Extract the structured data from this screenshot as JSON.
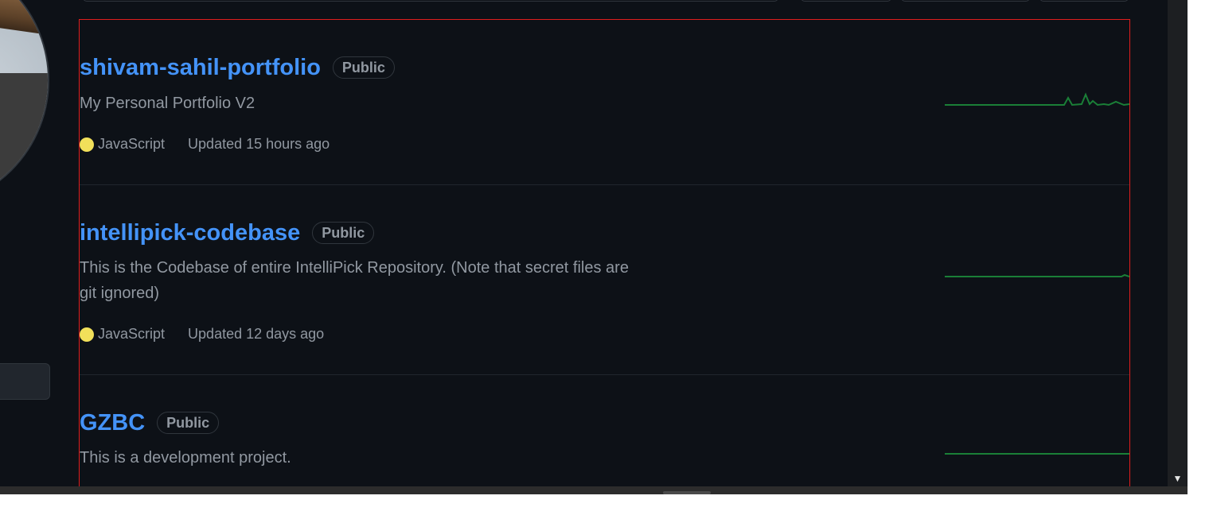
{
  "colors": {
    "background": "#0d1117",
    "link": "#4493f8",
    "muted_text": "#9198a1",
    "javascript": "#f1e05a",
    "sparkline": "#1a7f37",
    "highlight_outline": "#e01d1d"
  },
  "repositories": [
    {
      "name": "shivam-sahil-portfolio",
      "visibility": "Public",
      "description": "My Personal Portfolio V2",
      "language": "JavaScript",
      "updated": "Updated 15 hours ago"
    },
    {
      "name": "intellipick-codebase",
      "visibility": "Public",
      "description": "This is the Codebase of entire IntelliPick Repository. (Note that secret files are git ignored)",
      "language": "JavaScript",
      "updated": "Updated 12 days ago"
    },
    {
      "name": "GZBC",
      "visibility": "Public",
      "description": "This is a development project."
    }
  ],
  "icons": {
    "scroll_down": "triangle-down"
  }
}
